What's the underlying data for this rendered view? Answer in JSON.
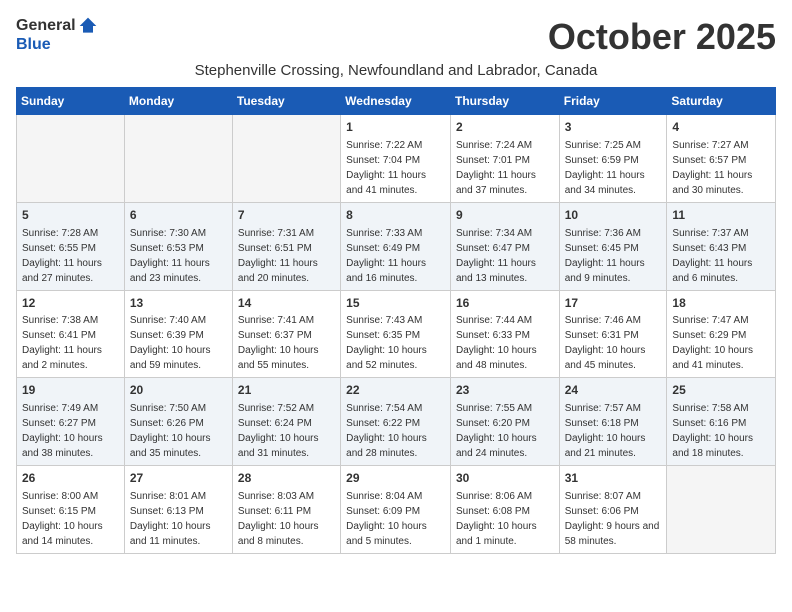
{
  "logo": {
    "general": "General",
    "blue": "Blue"
  },
  "title": "October 2025",
  "subtitle": "Stephenville Crossing, Newfoundland and Labrador, Canada",
  "days_of_week": [
    "Sunday",
    "Monday",
    "Tuesday",
    "Wednesday",
    "Thursday",
    "Friday",
    "Saturday"
  ],
  "weeks": [
    [
      {
        "day": "",
        "sunrise": "",
        "sunset": "",
        "daylight": ""
      },
      {
        "day": "",
        "sunrise": "",
        "sunset": "",
        "daylight": ""
      },
      {
        "day": "",
        "sunrise": "",
        "sunset": "",
        "daylight": ""
      },
      {
        "day": "1",
        "sunrise": "Sunrise: 7:22 AM",
        "sunset": "Sunset: 7:04 PM",
        "daylight": "Daylight: 11 hours and 41 minutes."
      },
      {
        "day": "2",
        "sunrise": "Sunrise: 7:24 AM",
        "sunset": "Sunset: 7:01 PM",
        "daylight": "Daylight: 11 hours and 37 minutes."
      },
      {
        "day": "3",
        "sunrise": "Sunrise: 7:25 AM",
        "sunset": "Sunset: 6:59 PM",
        "daylight": "Daylight: 11 hours and 34 minutes."
      },
      {
        "day": "4",
        "sunrise": "Sunrise: 7:27 AM",
        "sunset": "Sunset: 6:57 PM",
        "daylight": "Daylight: 11 hours and 30 minutes."
      }
    ],
    [
      {
        "day": "5",
        "sunrise": "Sunrise: 7:28 AM",
        "sunset": "Sunset: 6:55 PM",
        "daylight": "Daylight: 11 hours and 27 minutes."
      },
      {
        "day": "6",
        "sunrise": "Sunrise: 7:30 AM",
        "sunset": "Sunset: 6:53 PM",
        "daylight": "Daylight: 11 hours and 23 minutes."
      },
      {
        "day": "7",
        "sunrise": "Sunrise: 7:31 AM",
        "sunset": "Sunset: 6:51 PM",
        "daylight": "Daylight: 11 hours and 20 minutes."
      },
      {
        "day": "8",
        "sunrise": "Sunrise: 7:33 AM",
        "sunset": "Sunset: 6:49 PM",
        "daylight": "Daylight: 11 hours and 16 minutes."
      },
      {
        "day": "9",
        "sunrise": "Sunrise: 7:34 AM",
        "sunset": "Sunset: 6:47 PM",
        "daylight": "Daylight: 11 hours and 13 minutes."
      },
      {
        "day": "10",
        "sunrise": "Sunrise: 7:36 AM",
        "sunset": "Sunset: 6:45 PM",
        "daylight": "Daylight: 11 hours and 9 minutes."
      },
      {
        "day": "11",
        "sunrise": "Sunrise: 7:37 AM",
        "sunset": "Sunset: 6:43 PM",
        "daylight": "Daylight: 11 hours and 6 minutes."
      }
    ],
    [
      {
        "day": "12",
        "sunrise": "Sunrise: 7:38 AM",
        "sunset": "Sunset: 6:41 PM",
        "daylight": "Daylight: 11 hours and 2 minutes."
      },
      {
        "day": "13",
        "sunrise": "Sunrise: 7:40 AM",
        "sunset": "Sunset: 6:39 PM",
        "daylight": "Daylight: 10 hours and 59 minutes."
      },
      {
        "day": "14",
        "sunrise": "Sunrise: 7:41 AM",
        "sunset": "Sunset: 6:37 PM",
        "daylight": "Daylight: 10 hours and 55 minutes."
      },
      {
        "day": "15",
        "sunrise": "Sunrise: 7:43 AM",
        "sunset": "Sunset: 6:35 PM",
        "daylight": "Daylight: 10 hours and 52 minutes."
      },
      {
        "day": "16",
        "sunrise": "Sunrise: 7:44 AM",
        "sunset": "Sunset: 6:33 PM",
        "daylight": "Daylight: 10 hours and 48 minutes."
      },
      {
        "day": "17",
        "sunrise": "Sunrise: 7:46 AM",
        "sunset": "Sunset: 6:31 PM",
        "daylight": "Daylight: 10 hours and 45 minutes."
      },
      {
        "day": "18",
        "sunrise": "Sunrise: 7:47 AM",
        "sunset": "Sunset: 6:29 PM",
        "daylight": "Daylight: 10 hours and 41 minutes."
      }
    ],
    [
      {
        "day": "19",
        "sunrise": "Sunrise: 7:49 AM",
        "sunset": "Sunset: 6:27 PM",
        "daylight": "Daylight: 10 hours and 38 minutes."
      },
      {
        "day": "20",
        "sunrise": "Sunrise: 7:50 AM",
        "sunset": "Sunset: 6:26 PM",
        "daylight": "Daylight: 10 hours and 35 minutes."
      },
      {
        "day": "21",
        "sunrise": "Sunrise: 7:52 AM",
        "sunset": "Sunset: 6:24 PM",
        "daylight": "Daylight: 10 hours and 31 minutes."
      },
      {
        "day": "22",
        "sunrise": "Sunrise: 7:54 AM",
        "sunset": "Sunset: 6:22 PM",
        "daylight": "Daylight: 10 hours and 28 minutes."
      },
      {
        "day": "23",
        "sunrise": "Sunrise: 7:55 AM",
        "sunset": "Sunset: 6:20 PM",
        "daylight": "Daylight: 10 hours and 24 minutes."
      },
      {
        "day": "24",
        "sunrise": "Sunrise: 7:57 AM",
        "sunset": "Sunset: 6:18 PM",
        "daylight": "Daylight: 10 hours and 21 minutes."
      },
      {
        "day": "25",
        "sunrise": "Sunrise: 7:58 AM",
        "sunset": "Sunset: 6:16 PM",
        "daylight": "Daylight: 10 hours and 18 minutes."
      }
    ],
    [
      {
        "day": "26",
        "sunrise": "Sunrise: 8:00 AM",
        "sunset": "Sunset: 6:15 PM",
        "daylight": "Daylight: 10 hours and 14 minutes."
      },
      {
        "day": "27",
        "sunrise": "Sunrise: 8:01 AM",
        "sunset": "Sunset: 6:13 PM",
        "daylight": "Daylight: 10 hours and 11 minutes."
      },
      {
        "day": "28",
        "sunrise": "Sunrise: 8:03 AM",
        "sunset": "Sunset: 6:11 PM",
        "daylight": "Daylight: 10 hours and 8 minutes."
      },
      {
        "day": "29",
        "sunrise": "Sunrise: 8:04 AM",
        "sunset": "Sunset: 6:09 PM",
        "daylight": "Daylight: 10 hours and 5 minutes."
      },
      {
        "day": "30",
        "sunrise": "Sunrise: 8:06 AM",
        "sunset": "Sunset: 6:08 PM",
        "daylight": "Daylight: 10 hours and 1 minute."
      },
      {
        "day": "31",
        "sunrise": "Sunrise: 8:07 AM",
        "sunset": "Sunset: 6:06 PM",
        "daylight": "Daylight: 9 hours and 58 minutes."
      },
      {
        "day": "",
        "sunrise": "",
        "sunset": "",
        "daylight": ""
      }
    ]
  ]
}
